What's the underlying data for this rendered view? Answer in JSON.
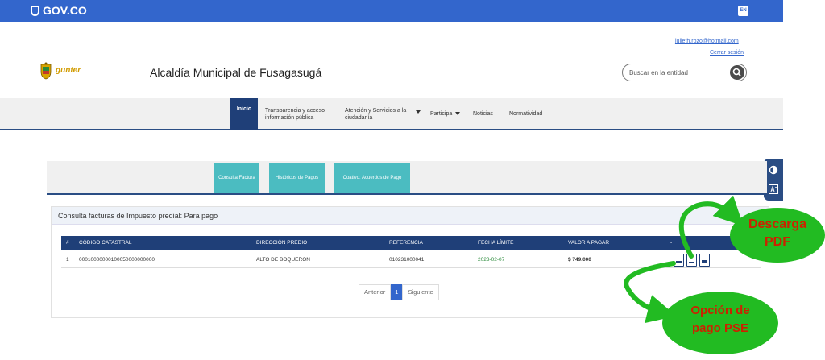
{
  "govbar": {
    "logo": "GOV.CO",
    "lang": "EN"
  },
  "header": {
    "user_email": "julieth.rozo@hotmail.com",
    "logout": "Cerrar sesión",
    "brand_logo": "gunter",
    "site_title": "Alcaldía Municipal de Fusagasugá",
    "search_placeholder": "Buscar en la entidad"
  },
  "nav": {
    "items": [
      {
        "label": "Inicio"
      },
      {
        "label": "Transparencia y acceso información pública"
      },
      {
        "label": "Atención y Servicios a la ciudadanía"
      },
      {
        "label": "Participa"
      },
      {
        "label": "Noticias"
      },
      {
        "label": "Normatividad"
      }
    ]
  },
  "tabs": [
    {
      "label": "Consulta Factura"
    },
    {
      "label": "Históricos de Pagos"
    },
    {
      "label": "Coativo: Acuerdos de Pago"
    }
  ],
  "card": {
    "title": "Consulta facturas de Impuesto predial: Para pago",
    "columns": [
      "#",
      "CÓDIGO CATASTRAL",
      "DIRECCIÓN PREDIO",
      "REFERENCIA",
      "FECHA LÍMITE",
      "VALOR A PAGAR",
      "-"
    ],
    "rows": [
      {
        "num": "1",
        "codigo": "00010000000100050000000000",
        "direccion": "ALTO DE BOQUERON",
        "referencia": "010231000041",
        "fecha": "2023-02-07",
        "valor": "$ 749.000"
      }
    ],
    "pagination": {
      "prev": "Anterior",
      "current": "1",
      "next": "Siguiente"
    }
  },
  "annotations": {
    "pdf_line1": "Descarga",
    "pdf_line2": "PDF",
    "pse_line1": "Opción de",
    "pse_line2": "pago PSE"
  },
  "colors": {
    "gov_blue": "#3366cc",
    "navy": "#1f3f78",
    "teal": "#4bbcc1",
    "bubble_green": "#22bb22",
    "bubble_text": "#cc2200"
  }
}
